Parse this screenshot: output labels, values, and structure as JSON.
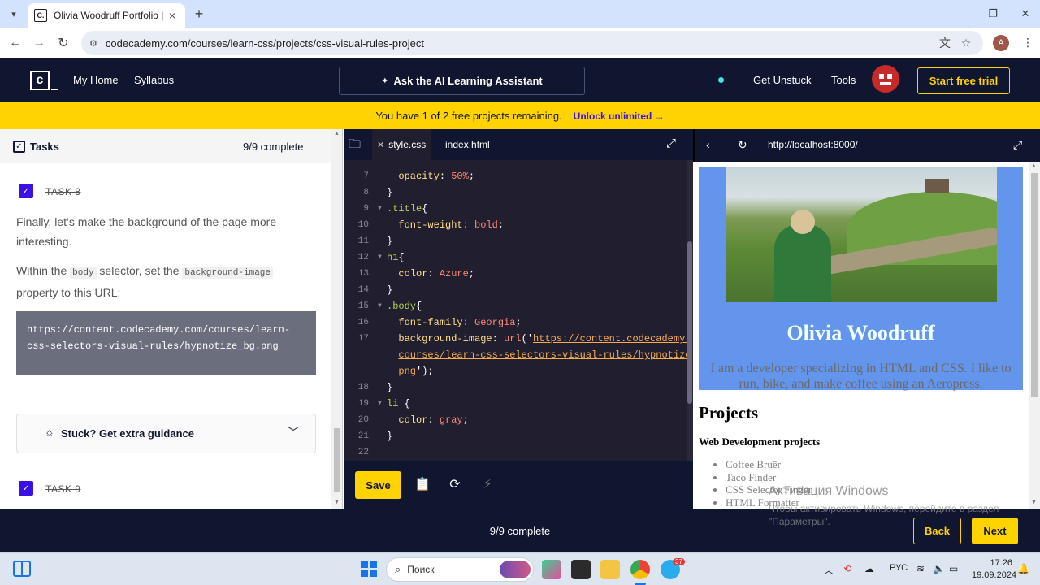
{
  "browser": {
    "tab_title": "Olivia Woodruff Portfolio | Codecademy",
    "favicon": "C.",
    "url": "codecademy.com/courses/learn-css/projects/css-visual-rules-project",
    "profile_initial": "A"
  },
  "nav": {
    "logo": "c",
    "my_home": "My Home",
    "syllabus": "Syllabus",
    "ai_button": "Ask the AI Learning Assistant",
    "get_unstuck": "Get Unstuck",
    "tools": "Tools",
    "start_trial": "Start free trial"
  },
  "banner": {
    "message": "You have 1 of 2 free projects remaining.",
    "unlock": "Unlock unlimited →"
  },
  "tasks": {
    "title": "Tasks",
    "count": "9/9 complete",
    "task8_label": "TASK 8",
    "task9_label": "TASK 9",
    "para1": "Finally, let’s make the background of the page more interesting.",
    "para2_prefix": "Within the ",
    "para2_code1": "body",
    "para2_mid": " selector, set the ",
    "para2_code2": "background-image",
    "para2_suffix": " property to this URL:",
    "code_block": "https://content.codecademy.com/courses/learn-css-selectors-visual-rules/hypnotize_bg.png",
    "stuck": "Stuck? Get extra guidance"
  },
  "editor": {
    "tabs": [
      "style.css",
      "index.html"
    ],
    "save": "Save"
  },
  "preview": {
    "url": "http://localhost:8000/",
    "name": "Olivia Woodruff",
    "bio": "I am a developer specializing in HTML and CSS. I like to run, bike, and make coffee using an Aeropress.",
    "projects_heading": "Projects",
    "subheading": "Web Development projects",
    "projects": [
      "Coffee Bruēr",
      "Taco Finder",
      "CSS Selector Finder",
      "HTML Formatter"
    ]
  },
  "footer": {
    "progress": "9/9 complete",
    "back": "Back",
    "next": "Next"
  },
  "watermark": {
    "line1": "Активация Windows",
    "line2": "Чтобы активировать Windows, перейдите в раздел \"Параметры\"."
  },
  "taskbar": {
    "search": "Поиск",
    "lang": "РУС",
    "time": "17:26",
    "date": "19.09.2024",
    "badge": "37"
  },
  "colors": {
    "nav_bg": "#10162f",
    "accent_yellow": "#ffd300",
    "accent_purple": "#3a10e5",
    "editor_bg": "#211e2f",
    "hero_bg": "#6495ed"
  }
}
